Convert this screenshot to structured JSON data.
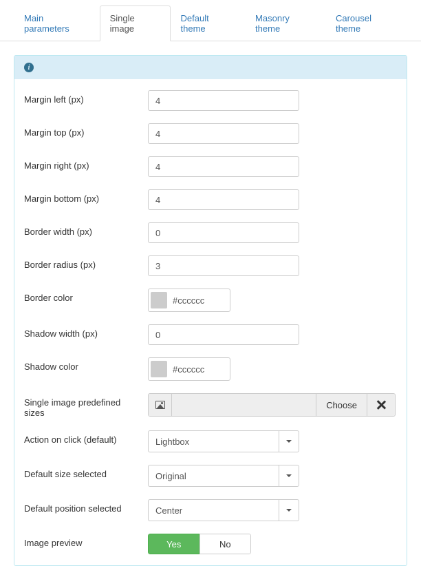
{
  "tabs": [
    {
      "label": "Main parameters",
      "active": false
    },
    {
      "label": "Single image",
      "active": true
    },
    {
      "label": "Default theme",
      "active": false
    },
    {
      "label": "Masonry theme",
      "active": false
    },
    {
      "label": "Carousel theme",
      "active": false
    }
  ],
  "fields": {
    "margin_left": {
      "label": "Margin left (px)",
      "value": "4"
    },
    "margin_top": {
      "label": "Margin top (px)",
      "value": "4"
    },
    "margin_right": {
      "label": "Margin right (px)",
      "value": "4"
    },
    "margin_bottom": {
      "label": "Margin bottom (px)",
      "value": "4"
    },
    "border_width": {
      "label": "Border width (px)",
      "value": "0"
    },
    "border_radius": {
      "label": "Border radius (px)",
      "value": "3"
    },
    "border_color": {
      "label": "Border color",
      "value": "#cccccc"
    },
    "shadow_width": {
      "label": "Shadow width (px)",
      "value": "0"
    },
    "shadow_color": {
      "label": "Shadow color",
      "value": "#cccccc"
    },
    "predefined_sizes": {
      "label": "Single image predefined sizes",
      "choose_label": "Choose"
    },
    "action_on_click": {
      "label": "Action on click (default)",
      "value": "Lightbox"
    },
    "default_size": {
      "label": "Default size selected",
      "value": "Original"
    },
    "default_position": {
      "label": "Default position selected",
      "value": "Center"
    },
    "image_preview": {
      "label": "Image preview",
      "yes": "Yes",
      "no": "No",
      "value": "Yes"
    }
  }
}
